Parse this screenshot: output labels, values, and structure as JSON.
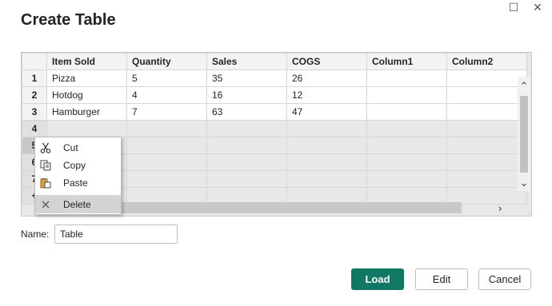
{
  "dialog": {
    "title": "Create Table"
  },
  "window": {
    "maximize_icon": "☐",
    "close_icon": "✕"
  },
  "table": {
    "columns": [
      "Item Sold",
      "Quantity",
      "Sales",
      "COGS",
      "Column1",
      "Column2"
    ],
    "rows": [
      {
        "num": "1",
        "cells": [
          "Pizza",
          "5",
          "35",
          "26",
          "",
          ""
        ]
      },
      {
        "num": "2",
        "cells": [
          "Hotdog",
          "4",
          "16",
          "12",
          "",
          ""
        ]
      },
      {
        "num": "3",
        "cells": [
          "Hamburger",
          "7",
          "63",
          "47",
          "",
          ""
        ]
      },
      {
        "num": "4",
        "cells": [
          "",
          "",
          "",
          "",
          "",
          ""
        ]
      },
      {
        "num": "5",
        "cells": [
          "",
          "",
          "",
          "",
          "",
          ""
        ]
      },
      {
        "num": "6",
        "cells": [
          "",
          "",
          "",
          "",
          "",
          ""
        ]
      },
      {
        "num": "7",
        "cells": [
          "",
          "",
          "",
          "",
          "",
          ""
        ]
      },
      {
        "num": "+",
        "cells": [
          "",
          "",
          "",
          "",
          "",
          ""
        ]
      }
    ]
  },
  "scrollbars": {
    "up": "⌃",
    "down": "⌄",
    "right": "›"
  },
  "context_menu": {
    "cut": "Cut",
    "copy": "Copy",
    "paste": "Paste",
    "delete": "Delete"
  },
  "name_field": {
    "label": "Name:",
    "value": "Table"
  },
  "buttons": {
    "load": "Load",
    "edit": "Edit",
    "cancel": "Cancel"
  },
  "colors": {
    "accent": "#117865"
  }
}
